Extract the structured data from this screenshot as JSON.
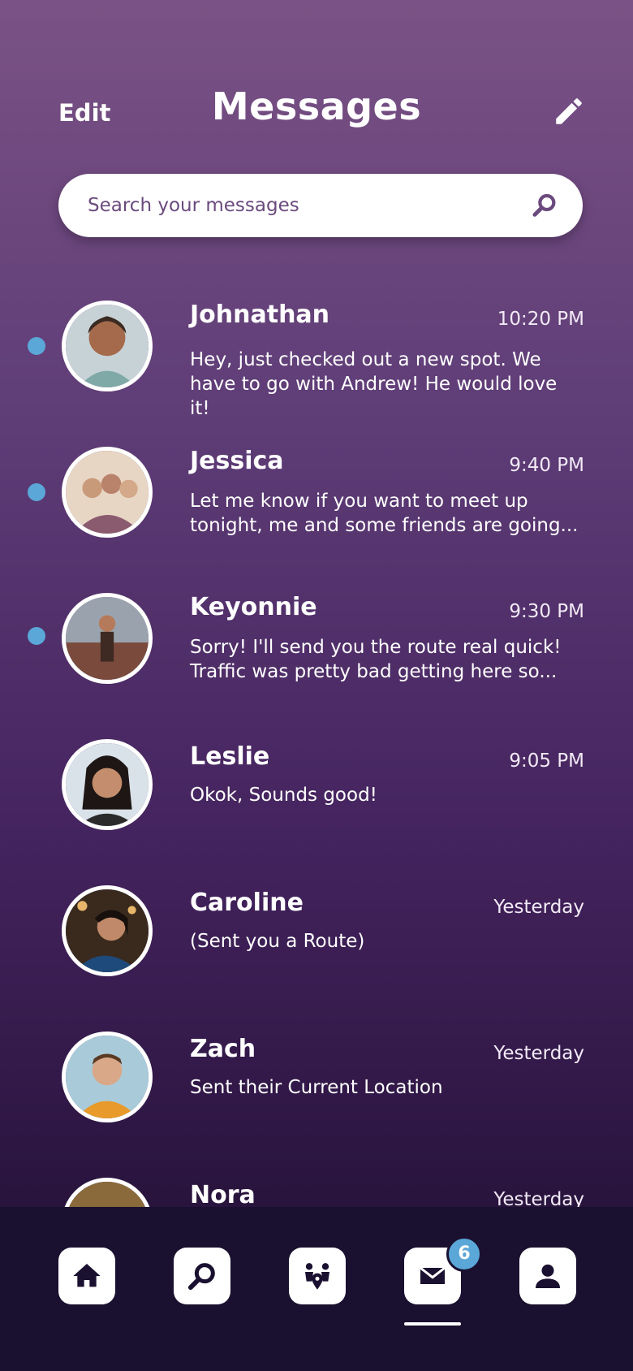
{
  "header": {
    "edit_label": "Edit",
    "title": "Messages",
    "compose_icon": "pencil-icon"
  },
  "search": {
    "placeholder": "Search your messages",
    "icon": "search-icon"
  },
  "conversations": [
    {
      "name": "Johnathan",
      "time": "10:20 PM",
      "preview": "Hey, just checked out a new spot. We\nhave to go with Andrew! He would love it!",
      "unread": true
    },
    {
      "name": "Jessica",
      "time": "9:40 PM",
      "preview": "Let me know if you want to meet up\ntonight, me and some friends are going...",
      "unread": true
    },
    {
      "name": "Keyonnie",
      "time": "9:30 PM",
      "preview": "Sorry! I'll send you the route real quick!\nTraffic was pretty bad getting here so...",
      "unread": true
    },
    {
      "name": "Leslie",
      "time": "9:05 PM",
      "preview": "Okok, Sounds good!",
      "unread": false
    },
    {
      "name": "Caroline",
      "time": "Yesterday",
      "preview": "(Sent you a Route)",
      "unread": false
    },
    {
      "name": "Zach",
      "time": "Yesterday",
      "preview": "Sent their Current Location",
      "unread": false
    },
    {
      "name": "Nora",
      "time": "Yesterday",
      "preview": "",
      "unread": false
    }
  ],
  "tabbar": {
    "tabs": [
      "home-icon",
      "search-icon",
      "people-location-icon",
      "mail-icon",
      "profile-icon"
    ],
    "active": "mail-icon",
    "mail_badge": "6"
  },
  "colors": {
    "unread_dot": "#5aa7d8",
    "tabbar_bg": "#1a1030",
    "accent": "#6b4a7e"
  }
}
